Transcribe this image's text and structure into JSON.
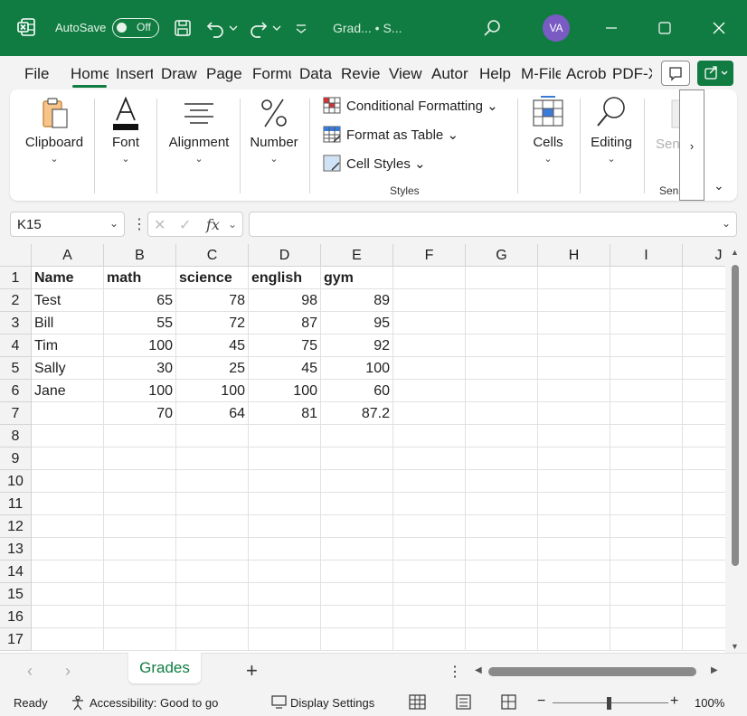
{
  "titlebar": {
    "autosave_label": "AutoSave",
    "autosave_state": "Off",
    "doc_title": "Grad...  •  S...",
    "avatar_initials": "VA",
    "bg_color": "#107c41"
  },
  "tabs": [
    "File",
    "Home",
    "Insert",
    "Draw",
    "Page",
    "Formu",
    "Data",
    "Revie",
    "View",
    "Autor",
    "Help",
    "M-File",
    "Acrob",
    "PDF-X"
  ],
  "active_tab": "Home",
  "ribbon": {
    "clipboard": "Clipboard",
    "font": "Font",
    "alignment": "Alignment",
    "number": "Number",
    "conditional_formatting": "Conditional Formatting",
    "format_as_table": "Format as Table",
    "cell_styles": "Cell Styles",
    "styles_group": "Styles",
    "cells": "Cells",
    "editing": "Editing",
    "sensitivity": "Sens",
    "sensitivity_group": "Sen"
  },
  "formula_bar": {
    "name_box": "K15",
    "fx": "fx",
    "formula": ""
  },
  "columns": [
    "A",
    "B",
    "C",
    "D",
    "E",
    "F",
    "G",
    "H",
    "I",
    "J"
  ],
  "rows": [
    "1",
    "2",
    "3",
    "4",
    "5",
    "6",
    "7",
    "8",
    "9",
    "10",
    "11",
    "12",
    "13",
    "14",
    "15",
    "16",
    "17"
  ],
  "cells": [
    [
      "Name",
      "math",
      "science",
      "english",
      "gym"
    ],
    [
      "Test",
      "65",
      "78",
      "98",
      "89"
    ],
    [
      "Bill",
      "55",
      "72",
      "87",
      "95"
    ],
    [
      "Tim",
      "100",
      "45",
      "75",
      "92"
    ],
    [
      "Sally",
      "30",
      "25",
      "45",
      "100"
    ],
    [
      "Jane",
      "100",
      "100",
      "100",
      "60"
    ],
    [
      "",
      "70",
      "64",
      "81",
      "87.2"
    ]
  ],
  "sheet_tab": "Grades",
  "statusbar": {
    "ready": "Ready",
    "accessibility": "Accessibility: Good to go",
    "display_settings": "Display Settings",
    "zoom": "100%"
  }
}
